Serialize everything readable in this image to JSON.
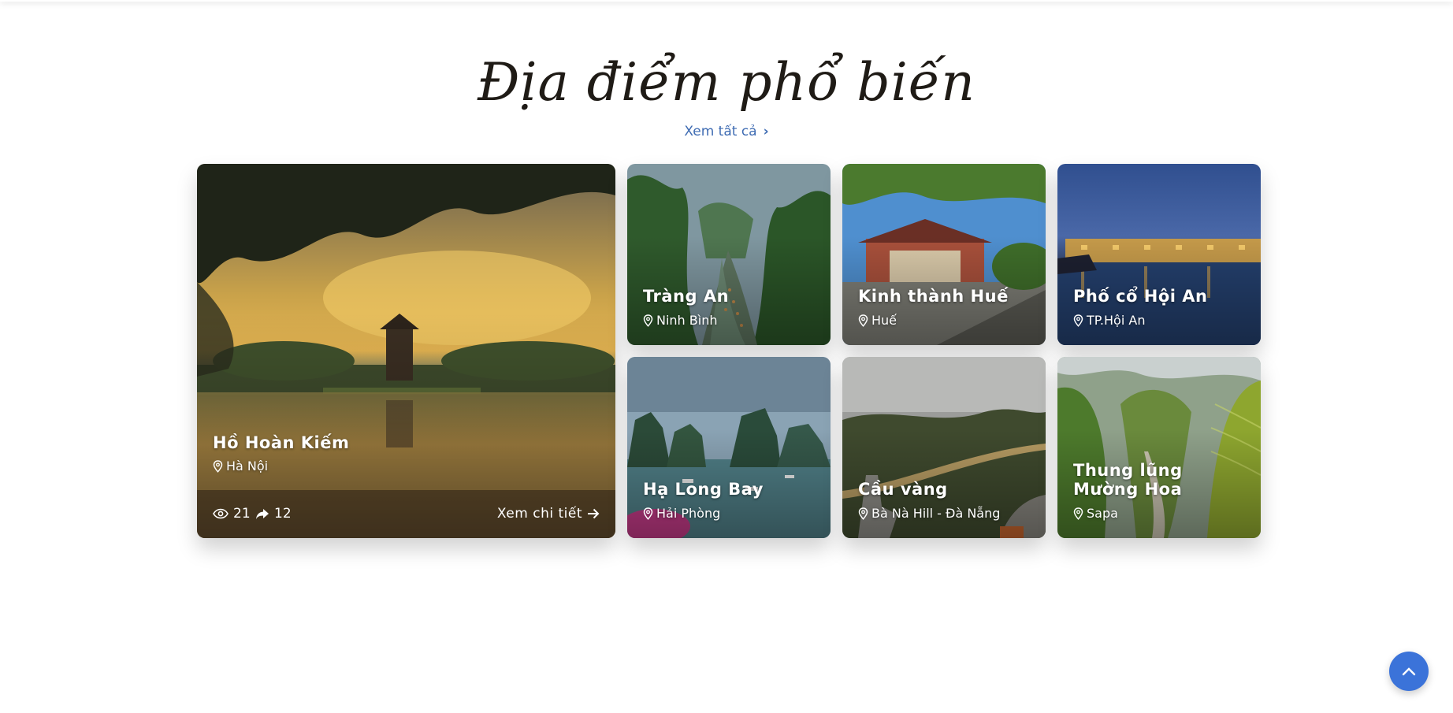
{
  "section": {
    "title": "Địa điểm phổ biến",
    "view_all": "Xem tất cả"
  },
  "featured": {
    "title": "Hồ Hoàn Kiếm",
    "location": "Hà Nội",
    "views": "21",
    "shares": "12",
    "detail_label": "Xem chi tiết"
  },
  "places": [
    {
      "title": "Tràng An",
      "location": "Ninh Bình"
    },
    {
      "title": "Kinh thành Huế",
      "location": "Huế"
    },
    {
      "title": "Phố cổ Hội An",
      "location": "TP.Hội An"
    },
    {
      "title": "Hạ Long Bay",
      "location": "Hải Phòng"
    },
    {
      "title": "Cầu vàng",
      "location": "Bà Nà Hill - Đà Nẵng"
    },
    {
      "title": "Thung lũng Mường Hoa",
      "location": "Sapa"
    }
  ],
  "colors": {
    "accent": "#3b73d9",
    "link": "#3f6cb3"
  },
  "icons": {
    "location": "map-pin-icon",
    "views": "eye-icon",
    "shares": "share-icon",
    "detail": "arrow-right-icon",
    "scroll": "chevron-up-icon"
  }
}
